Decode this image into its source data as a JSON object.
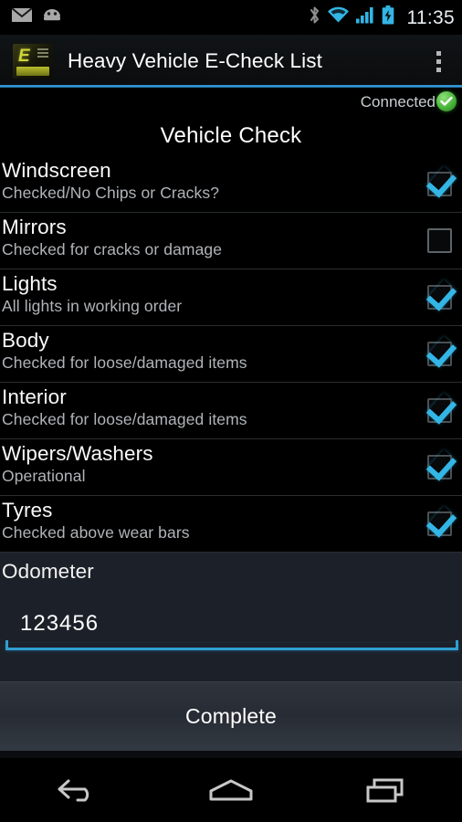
{
  "status_bar": {
    "time": "11:35",
    "left_icons": [
      "email-icon",
      "android-bot-icon"
    ],
    "right_icons": [
      "bluetooth-icon",
      "wifi-icon",
      "cellular-signal-icon",
      "battery-charging-icon"
    ],
    "colors": {
      "accent": "#33b5e5",
      "inactive": "#9a9a9a",
      "text": "#e9eef2"
    }
  },
  "action_bar": {
    "app_icon": "heavy-vehicle-logo-icon",
    "app_icon_glyph": "E",
    "title": "Heavy Vehicle E-Check List",
    "overflow_icon": "overflow-menu-icon",
    "underline_color": "#36a2e2"
  },
  "connection": {
    "label": "Connected",
    "status_icon": "green-check-badge-icon",
    "status_color": "#49b53a"
  },
  "page": {
    "heading": "Vehicle Check"
  },
  "checklist": {
    "items": [
      {
        "title": "Windscreen",
        "subtitle": "Checked/No Chips or Cracks?",
        "checked": true
      },
      {
        "title": "Mirrors",
        "subtitle": "Checked for cracks or damage",
        "checked": false
      },
      {
        "title": "Lights",
        "subtitle": "All lights in working order",
        "checked": true
      },
      {
        "title": "Body",
        "subtitle": "Checked for loose/damaged items",
        "checked": true
      },
      {
        "title": "Interior",
        "subtitle": "Checked for loose/damaged items",
        "checked": true
      },
      {
        "title": "Wipers/Washers",
        "subtitle": "Operational",
        "checked": true
      },
      {
        "title": "Tyres",
        "subtitle": "Checked above wear bars",
        "checked": true
      }
    ]
  },
  "odometer": {
    "label": "Odometer",
    "value": "123456",
    "placeholder": "",
    "underline_color": "#2f9fd0"
  },
  "actions": {
    "complete_label": "Complete"
  },
  "nav_bar": {
    "back_icon": "back-arrow-icon",
    "home_icon": "home-icon",
    "recents_icon": "recent-apps-icon"
  }
}
